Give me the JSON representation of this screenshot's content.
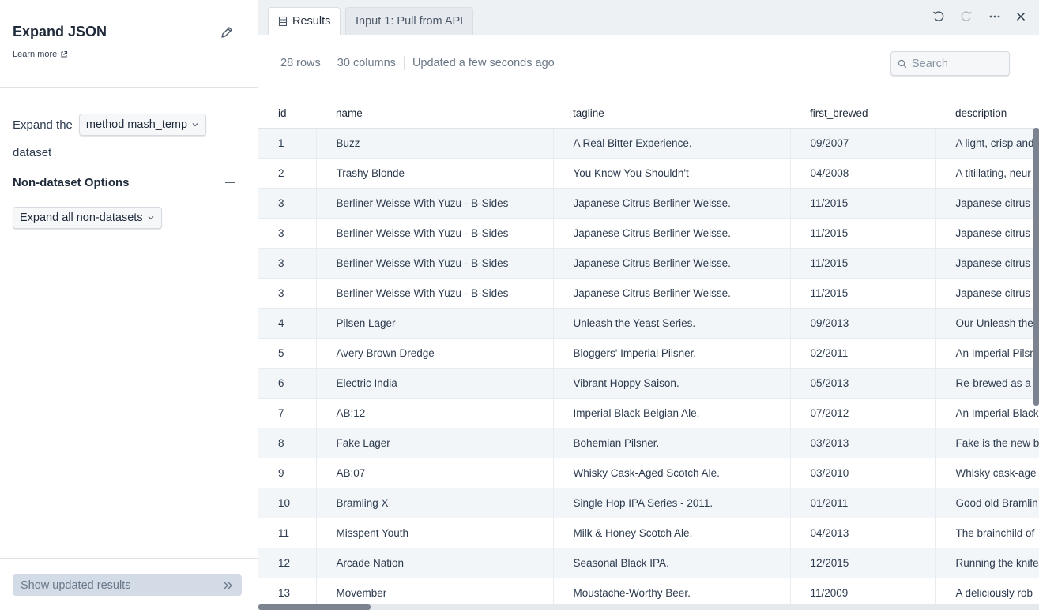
{
  "panel": {
    "title": "Expand JSON",
    "learn_more": "Learn more",
    "expand_the": "Expand the",
    "dataset_select": "method mash_temp",
    "dataset_word": "dataset",
    "nondataset_heading": "Non-dataset Options",
    "nondataset_select": "Expand all non-datasets",
    "show_button": "Show updated results"
  },
  "tabs": [
    {
      "label": "Results"
    },
    {
      "label": "Input 1: Pull from API"
    }
  ],
  "stats": {
    "rows": "28 rows",
    "columns": "30 columns",
    "updated": "Updated a few seconds ago"
  },
  "search": {
    "placeholder": "Search"
  },
  "table": {
    "columns": [
      "id",
      "name",
      "tagline",
      "first_brewed",
      "description"
    ],
    "rows": [
      [
        "1",
        "Buzz",
        "A Real Bitter Experience.",
        "09/2007",
        "A light, crisp and"
      ],
      [
        "2",
        "Trashy Blonde",
        "You Know You Shouldn't",
        "04/2008",
        "A titillating, neur"
      ],
      [
        "3",
        "Berliner Weisse With Yuzu - B-Sides",
        "Japanese Citrus Berliner Weisse.",
        "11/2015",
        "Japanese citrus"
      ],
      [
        "3",
        "Berliner Weisse With Yuzu - B-Sides",
        "Japanese Citrus Berliner Weisse.",
        "11/2015",
        "Japanese citrus"
      ],
      [
        "3",
        "Berliner Weisse With Yuzu - B-Sides",
        "Japanese Citrus Berliner Weisse.",
        "11/2015",
        "Japanese citrus"
      ],
      [
        "3",
        "Berliner Weisse With Yuzu - B-Sides",
        "Japanese Citrus Berliner Weisse.",
        "11/2015",
        "Japanese citrus"
      ],
      [
        "4",
        "Pilsen Lager",
        "Unleash the Yeast Series.",
        "09/2013",
        "Our Unleash the"
      ],
      [
        "5",
        "Avery Brown Dredge",
        "Bloggers' Imperial Pilsner.",
        "02/2011",
        "An Imperial Pilsn"
      ],
      [
        "6",
        "Electric India",
        "Vibrant Hoppy Saison.",
        "05/2013",
        "Re-brewed as a"
      ],
      [
        "7",
        "AB:12",
        "Imperial Black Belgian Ale.",
        "07/2012",
        "An Imperial Black"
      ],
      [
        "8",
        "Fake Lager",
        "Bohemian Pilsner.",
        "03/2013",
        "Fake is the new b"
      ],
      [
        "9",
        "AB:07",
        "Whisky Cask-Aged Scotch Ale.",
        "03/2010",
        "Whisky cask-age"
      ],
      [
        "10",
        "Bramling X",
        "Single Hop IPA Series - 2011.",
        "01/2011",
        "Good old Bramlin"
      ],
      [
        "11",
        "Misspent Youth",
        "Milk & Honey Scotch Ale.",
        "04/2013",
        "The brainchild of"
      ],
      [
        "12",
        "Arcade Nation",
        "Seasonal Black IPA.",
        "12/2015",
        "Running the knife"
      ],
      [
        "13",
        "Movember",
        "Moustache-Worthy Beer.",
        "11/2009",
        "A deliciously rob"
      ]
    ]
  }
}
